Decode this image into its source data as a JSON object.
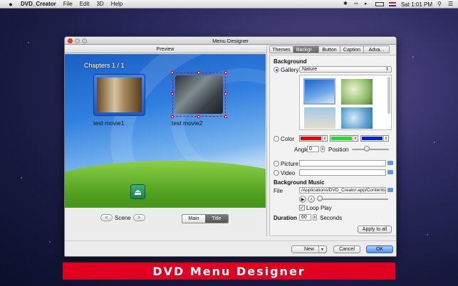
{
  "menubar": {
    "app_name": "DVD_Creator",
    "menus": [
      "File",
      "Edit",
      "3D",
      "Help"
    ],
    "clock": "Sat 1:01 PM"
  },
  "window": {
    "title": "Menu Designer"
  },
  "preview": {
    "header": "Preview",
    "chapters_label": "Chapters 1 / 1",
    "items": [
      {
        "label": "test movie1"
      },
      {
        "label": "test movie2"
      }
    ]
  },
  "nav": {
    "scene_label": "Scene",
    "prev_glyph": "<",
    "next_glyph": ">",
    "segments": [
      "Main",
      "Title"
    ],
    "selected_segment": "Title"
  },
  "tabs": [
    "Themes",
    "Backgr...",
    "Button",
    "Caption",
    "Adva..."
  ],
  "selected_tab": "Backgr...",
  "background": {
    "section_title": "Background",
    "gallery_label": "Gallery",
    "gallery_selected": "Nature",
    "color_label": "Color",
    "colors": [
      "#ee0000",
      "#22dd22",
      "#0022dd"
    ],
    "angle_label": "Angle",
    "angle_value": "0",
    "position_label": "Position",
    "position_fraction": 0.55,
    "picture_label": "Picture",
    "video_label": "Video"
  },
  "music": {
    "section_title": "Background Music",
    "file_label": "File",
    "file_path": "/Applications/DVD_Creator.app/Contents...",
    "loop_label": "Loop Play",
    "loop_checked": true
  },
  "duration": {
    "label": "Duration",
    "value": "60",
    "unit": "Seconds"
  },
  "buttons": {
    "apply_all": "Apply to all",
    "new": "New",
    "cancel": "Cancel",
    "ok": "OK"
  },
  "banner": {
    "text": "DVD Menu Designer"
  }
}
